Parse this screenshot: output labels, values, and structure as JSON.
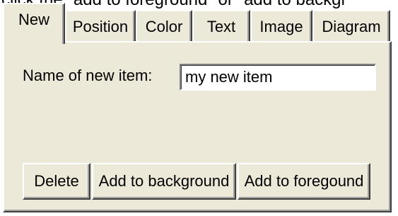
{
  "caption": "click the \"add to foreground\" or \"add to backgr",
  "tabs": [
    {
      "label": "New",
      "active": true
    },
    {
      "label": "Position",
      "active": false
    },
    {
      "label": "Color",
      "active": false
    },
    {
      "label": "Text",
      "active": false
    },
    {
      "label": "Image",
      "active": false
    },
    {
      "label": "Diagram",
      "active": false
    }
  ],
  "new_panel": {
    "name_label": "Name of new item:",
    "name_value": "my new item",
    "buttons": {
      "delete": "Delete",
      "add_background": "Add to background",
      "add_foreground": "Add to foregound"
    }
  },
  "colors": {
    "face": "#ece9d8",
    "highlight": "#ffffff",
    "shadow": "#404040"
  }
}
